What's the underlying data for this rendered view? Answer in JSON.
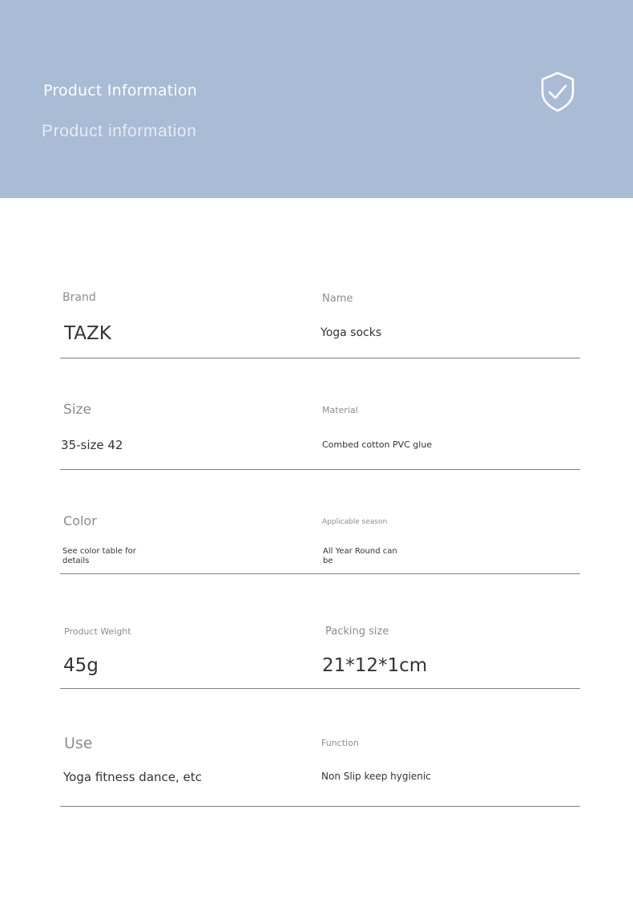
{
  "header": {
    "title": "Product Information",
    "subtitle": "Product information",
    "icon": "shield-check-icon",
    "background_color": "#a9bbd5"
  },
  "specs": {
    "brand": {
      "label": "Brand",
      "value": "TAZK"
    },
    "name": {
      "label": "Name",
      "value": "Yoga socks"
    },
    "size": {
      "label": "Size",
      "value": "35-size 42"
    },
    "material": {
      "label": "Material",
      "value": "Combed cotton PVC glue"
    },
    "color": {
      "label": "Color",
      "value": "See color table for details"
    },
    "season": {
      "label": "Applicable season",
      "value": "All Year Round can be"
    },
    "weight": {
      "label": "Product Weight",
      "value": "45g"
    },
    "packing": {
      "label": "Packing size",
      "value": "21*12*1cm"
    },
    "use": {
      "label": "Use",
      "value": "Yoga fitness dance, etc"
    },
    "function": {
      "label": "Function",
      "value": "Non Slip keep hygienic"
    }
  }
}
